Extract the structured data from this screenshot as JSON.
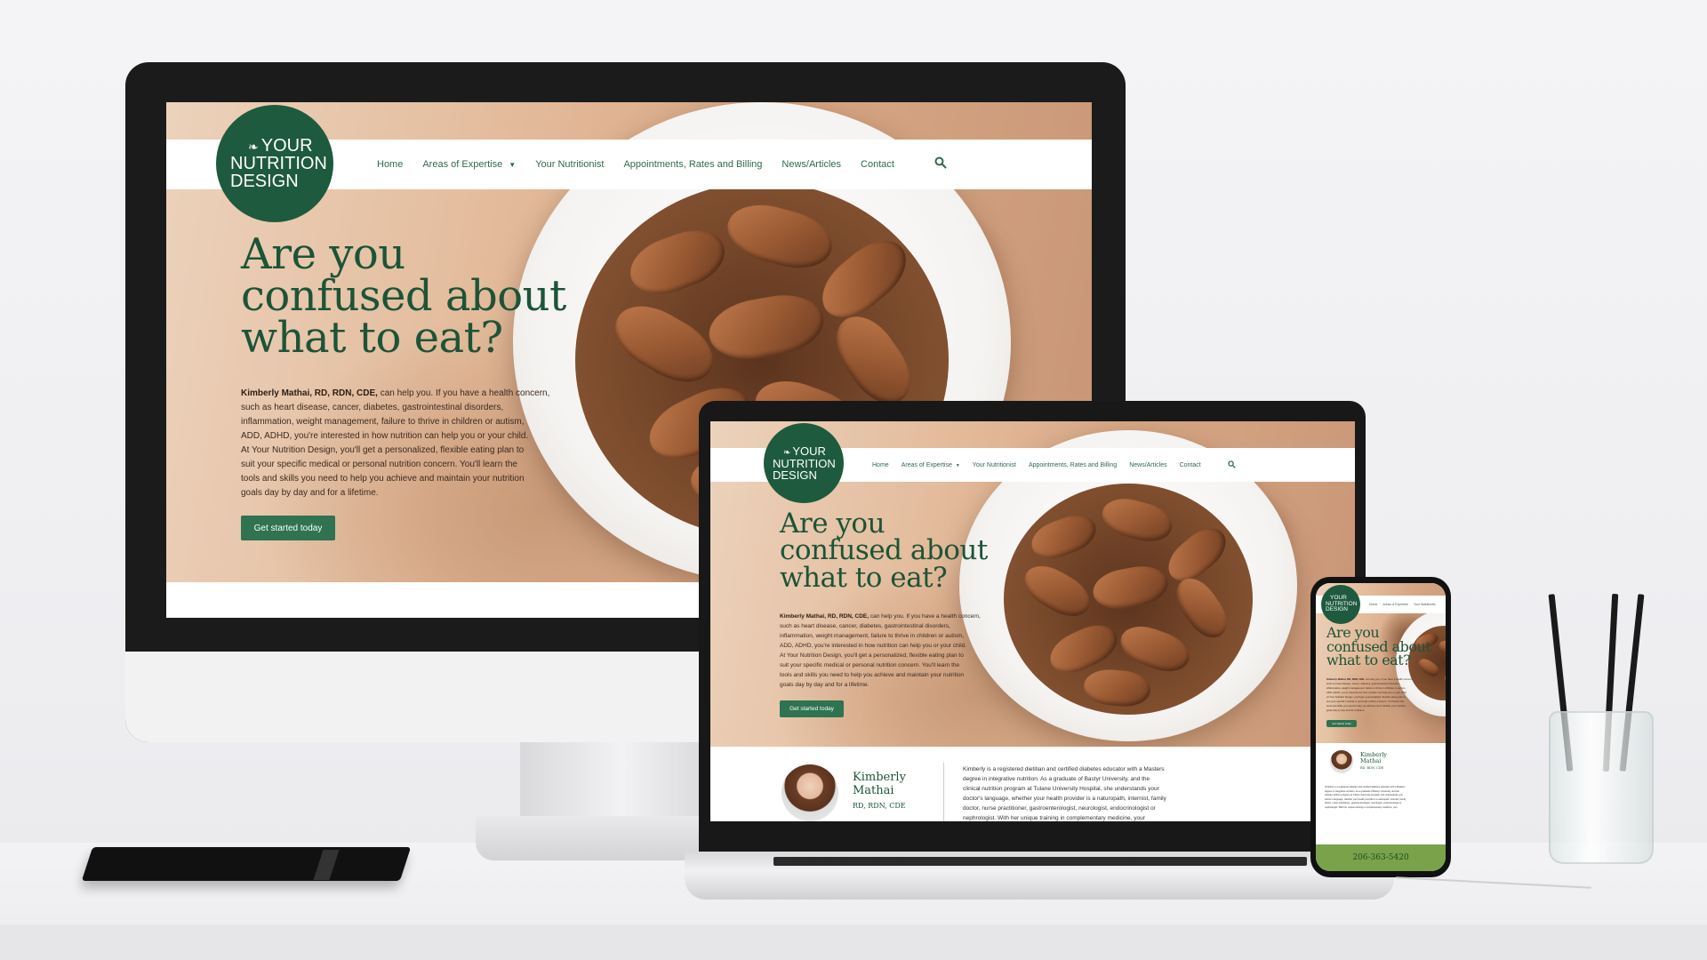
{
  "site": {
    "logo_lines": [
      "YOUR",
      "NUTRITION",
      "DESIGN"
    ],
    "nav": [
      "Home",
      "Areas of Expertise",
      "Your Nutritionist",
      "Appointments, Rates and Billing",
      "News/Articles",
      "Contact"
    ],
    "hero_title_lines": [
      "Are you",
      "confused about",
      "what to eat?"
    ],
    "hero_body_lead": "Kimberly Mathai, RD, RDN, CDE,",
    "hero_body_lines": [
      "can help you. If you have a health concern,",
      "such as heart disease, cancer, diabetes, gastrointestinal disorders,",
      "inflammation, weight management, failure to thrive in children or autism,",
      "ADD, ADHD, you're interested in how nutrition can help you or your child.",
      "At Your Nutrition Design, you'll get a personalized, flexible eating plan to",
      "suit your specific medical or personal nutrition concern. You'll learn the",
      "tools and skills you need to help you achieve and maintain your nutrition",
      "goals day by day and for a lifetime."
    ],
    "cta": "Get started today",
    "profile_name_lines": [
      "Kimberly",
      "Mathai"
    ],
    "profile_creds": "RD, RDN, CDE",
    "profile_bio_lines": [
      "Kimberly is a registered dietitian and certified diabetes educator with a Masters",
      "degree in integrative nutrition. As a graduate of Bastyr University, and the",
      "clinical nutrition program at Tulane University Hospital, she understands your",
      "doctor's language, whether your health provider is a naturopath, internist, family",
      "doctor, nurse practitioner, gastroenterologist, neurologist, endocrinologist or",
      "nephrologist. With her unique training in complementary medicine, your"
    ],
    "phone_number": "206-363-5420"
  },
  "colors": {
    "brand_green": "#1e5a3d",
    "nav_green": "#2f6a4c",
    "cta_green": "#2f7350",
    "phone_bar": "#7aa24a"
  },
  "icons": {
    "search": "search-icon",
    "dropdown": "chevron-down-icon",
    "logo_leaf": "leaf-icon"
  }
}
